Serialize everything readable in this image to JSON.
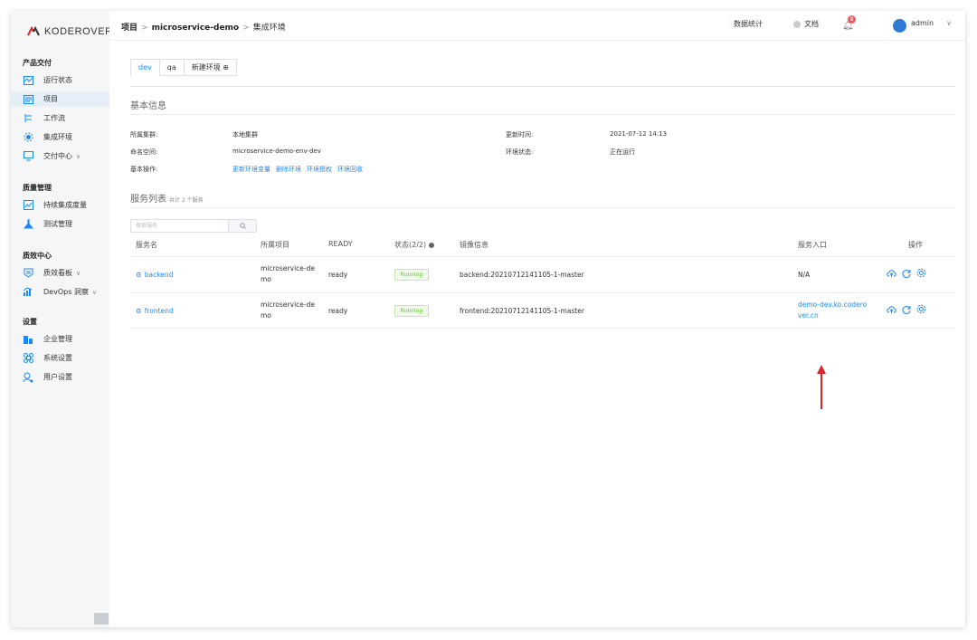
{
  "brand": {
    "name": "KODEROVER"
  },
  "sidebar": {
    "groups": [
      {
        "title": "产品交付",
        "items": [
          {
            "label": "运行状态",
            "icon": "dashboard-icon"
          },
          {
            "label": "项目",
            "icon": "project-icon",
            "active": true
          },
          {
            "label": "工作流",
            "icon": "workflow-icon"
          },
          {
            "label": "集成环境",
            "icon": "environment-icon"
          },
          {
            "label": "交付中心",
            "icon": "delivery-icon",
            "has_caret": true
          }
        ]
      },
      {
        "title": "质量管理",
        "items": [
          {
            "label": "持续集成度量",
            "icon": "metrics-icon"
          },
          {
            "label": "测试管理",
            "icon": "test-icon"
          }
        ]
      },
      {
        "title": "质效中心",
        "items": [
          {
            "label": "质效看板",
            "icon": "board-icon",
            "has_caret": true
          },
          {
            "label": "DevOps 洞察",
            "icon": "insight-icon",
            "has_caret": true
          }
        ]
      },
      {
        "title": "设置",
        "items": [
          {
            "label": "企业管理",
            "icon": "enterprise-icon"
          },
          {
            "label": "系统设置",
            "icon": "system-settings-icon"
          },
          {
            "label": "用户设置",
            "icon": "user-settings-icon"
          }
        ]
      }
    ]
  },
  "header": {
    "breadcrumb": [
      "项目",
      "microservice-demo",
      "集成环境"
    ],
    "stats_label": "数据统计",
    "docs_label": "文档",
    "notification_count": "8",
    "user": "admin"
  },
  "tabs": [
    {
      "label": "dev",
      "active": true
    },
    {
      "label": "qa"
    },
    {
      "label": "新建环境 ⊕"
    }
  ],
  "basic_info": {
    "title": "基本信息",
    "cluster_label": "所属集群:",
    "cluster_value": "本地集群",
    "namespace_label": "命名空间:",
    "namespace_value": "microservice-demo-env-dev",
    "ops_label": "基本操作:",
    "ops_links": [
      "更新环境变量",
      "删除环境",
      "环境授权",
      "环境回收"
    ],
    "updated_label": "更新时间:",
    "updated_value": "2021-07-12 14:13",
    "status_label": "环境状态:",
    "status_value": "正在运行"
  },
  "services": {
    "title": "服务列表",
    "count_text": "共计 2 个服务",
    "search_placeholder": "搜索服务",
    "columns": [
      "服务名",
      "所属项目",
      "READY",
      "状态(2/2)",
      "镜像信息",
      "服务入口",
      "操作"
    ],
    "rows": [
      {
        "name": "backend",
        "project_line1": "microservice-de",
        "project_line2": "mo",
        "ready": "ready",
        "status": "Running",
        "image": "backend:20210712141105-1-master",
        "entry_line1": "N/A",
        "entry_line2": ""
      },
      {
        "name": "frontend",
        "project_line1": "microservice-de",
        "project_line2": "mo",
        "ready": "ready",
        "status": "Running",
        "image": "frontend:20210712141105-1-master",
        "entry_line1": "demo-dev.ko.codero",
        "entry_line2": "ver.cn"
      }
    ]
  },
  "colors": {
    "accent": "#1989fa",
    "running_text": "#67c23a",
    "arrow": "#d9262c",
    "badge": "#f5555c"
  }
}
